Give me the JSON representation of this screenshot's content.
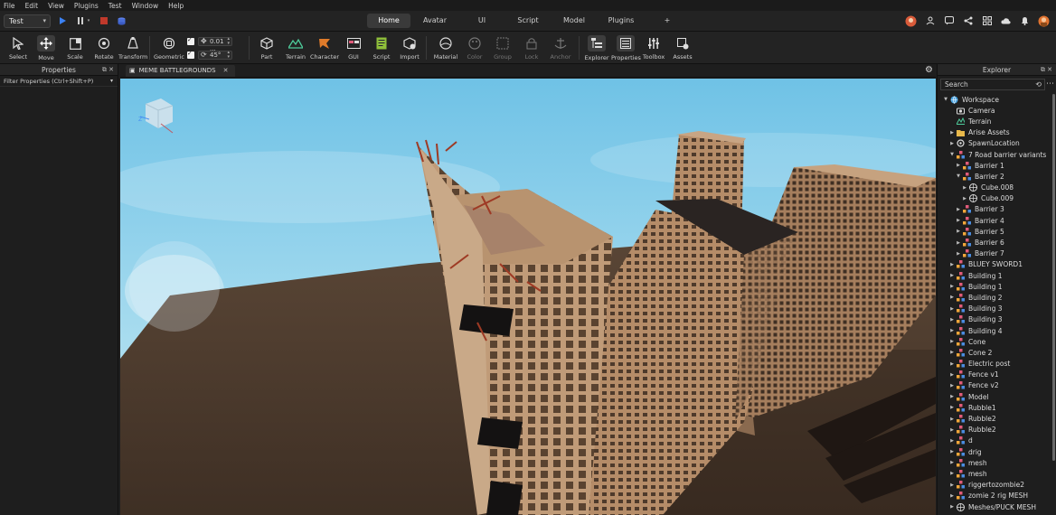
{
  "menu": [
    "File",
    "Edit",
    "View",
    "Plugins",
    "Test",
    "Window",
    "Help"
  ],
  "mode_select": "Test",
  "ribbon_tabs": [
    {
      "label": "Home",
      "active": true
    },
    {
      "label": "Avatar",
      "active": false
    },
    {
      "label": "UI",
      "active": false
    },
    {
      "label": "Script",
      "active": false
    },
    {
      "label": "Model",
      "active": false
    },
    {
      "label": "Plugins",
      "active": false
    },
    {
      "label": "+",
      "active": false
    }
  ],
  "tools": {
    "select": "Select",
    "move": "Move",
    "scale": "Scale",
    "rotate": "Rotate",
    "transform": "Transform",
    "geometric": "Geometric",
    "move_snap": "0.01 ...",
    "rotate_snap": "45°",
    "part": "Part",
    "terrain": "Terrain",
    "character": "Character",
    "gui": "GUI",
    "script": "Script",
    "import": "Import",
    "material": "Material",
    "color": "Color",
    "group": "Group",
    "lock": "Lock",
    "anchor": "Anchor",
    "explorer": "Explorer",
    "properties": "Properties",
    "toolbox": "Toolbox",
    "assets": "Assets"
  },
  "properties_panel": {
    "title": "Properties",
    "filter_placeholder": "Filter Properties (Ctrl+Shift+P)"
  },
  "document_tab": "MEME BATTLEGROUNDS",
  "explorer_panel": {
    "title": "Explorer",
    "search_placeholder": "Search",
    "tree": [
      {
        "label": "Workspace",
        "depth": 0,
        "expanded": true,
        "icon": "globe"
      },
      {
        "label": "Camera",
        "depth": 1,
        "icon": "camera"
      },
      {
        "label": "Terrain",
        "depth": 1,
        "icon": "terrain"
      },
      {
        "label": "Arise Assets",
        "depth": 1,
        "collapsed": true,
        "icon": "folder"
      },
      {
        "label": "SpawnLocation",
        "depth": 1,
        "collapsed": true,
        "icon": "spawn"
      },
      {
        "label": "7 Road barrier variants",
        "depth": 1,
        "expanded": true,
        "icon": "model"
      },
      {
        "label": "Barrier 1",
        "depth": 2,
        "collapsed": true,
        "icon": "model"
      },
      {
        "label": "Barrier 2",
        "depth": 2,
        "expanded": true,
        "icon": "model"
      },
      {
        "label": "Cube.008",
        "depth": 3,
        "collapsed": true,
        "icon": "mesh"
      },
      {
        "label": "Cube.009",
        "depth": 3,
        "collapsed": true,
        "icon": "mesh"
      },
      {
        "label": "Barrier 3",
        "depth": 2,
        "collapsed": true,
        "icon": "model"
      },
      {
        "label": "Barrier 4",
        "depth": 2,
        "collapsed": true,
        "icon": "model"
      },
      {
        "label": "Barrier 5",
        "depth": 2,
        "collapsed": true,
        "icon": "model"
      },
      {
        "label": "Barrier 6",
        "depth": 2,
        "collapsed": true,
        "icon": "model"
      },
      {
        "label": "Barrier 7",
        "depth": 2,
        "collapsed": true,
        "icon": "model"
      },
      {
        "label": "BLUEY SWORD1",
        "depth": 1,
        "collapsed": true,
        "icon": "model"
      },
      {
        "label": "Building 1",
        "depth": 1,
        "collapsed": true,
        "icon": "model"
      },
      {
        "label": "Building 1",
        "depth": 1,
        "collapsed": true,
        "icon": "model"
      },
      {
        "label": "Building 2",
        "depth": 1,
        "collapsed": true,
        "icon": "model"
      },
      {
        "label": "Building 3",
        "depth": 1,
        "collapsed": true,
        "icon": "model"
      },
      {
        "label": "Building 3",
        "depth": 1,
        "collapsed": true,
        "icon": "model"
      },
      {
        "label": "Building 4",
        "depth": 1,
        "collapsed": true,
        "icon": "model"
      },
      {
        "label": "Cone",
        "depth": 1,
        "collapsed": true,
        "icon": "model"
      },
      {
        "label": "Cone 2",
        "depth": 1,
        "collapsed": true,
        "icon": "model"
      },
      {
        "label": "Electric post",
        "depth": 1,
        "collapsed": true,
        "icon": "model"
      },
      {
        "label": "Fence v1",
        "depth": 1,
        "collapsed": true,
        "icon": "model"
      },
      {
        "label": "Fence v2",
        "depth": 1,
        "collapsed": true,
        "icon": "model"
      },
      {
        "label": "Model",
        "depth": 1,
        "collapsed": true,
        "icon": "model"
      },
      {
        "label": "Rubble1",
        "depth": 1,
        "collapsed": true,
        "icon": "model"
      },
      {
        "label": "Rubble2",
        "depth": 1,
        "collapsed": true,
        "icon": "model"
      },
      {
        "label": "Rubble2",
        "depth": 1,
        "collapsed": true,
        "icon": "model"
      },
      {
        "label": "d",
        "depth": 1,
        "collapsed": true,
        "icon": "model"
      },
      {
        "label": "drig",
        "depth": 1,
        "collapsed": true,
        "icon": "model"
      },
      {
        "label": "mesh",
        "depth": 1,
        "collapsed": true,
        "icon": "model"
      },
      {
        "label": "mesh",
        "depth": 1,
        "collapsed": true,
        "icon": "model"
      },
      {
        "label": "riggertozombie2",
        "depth": 1,
        "collapsed": true,
        "icon": "model"
      },
      {
        "label": "zomie 2 rig MESH",
        "depth": 1,
        "collapsed": true,
        "icon": "model"
      },
      {
        "label": "Meshes/PUCK MESH",
        "depth": 1,
        "collapsed": true,
        "icon": "mesh"
      }
    ]
  },
  "colors": {
    "accent_blue": "#3b82f6",
    "stop_red": "#c0392b",
    "sky": "#7cc7e6",
    "ground": "#4a3a2e",
    "building": "#b08a68"
  }
}
